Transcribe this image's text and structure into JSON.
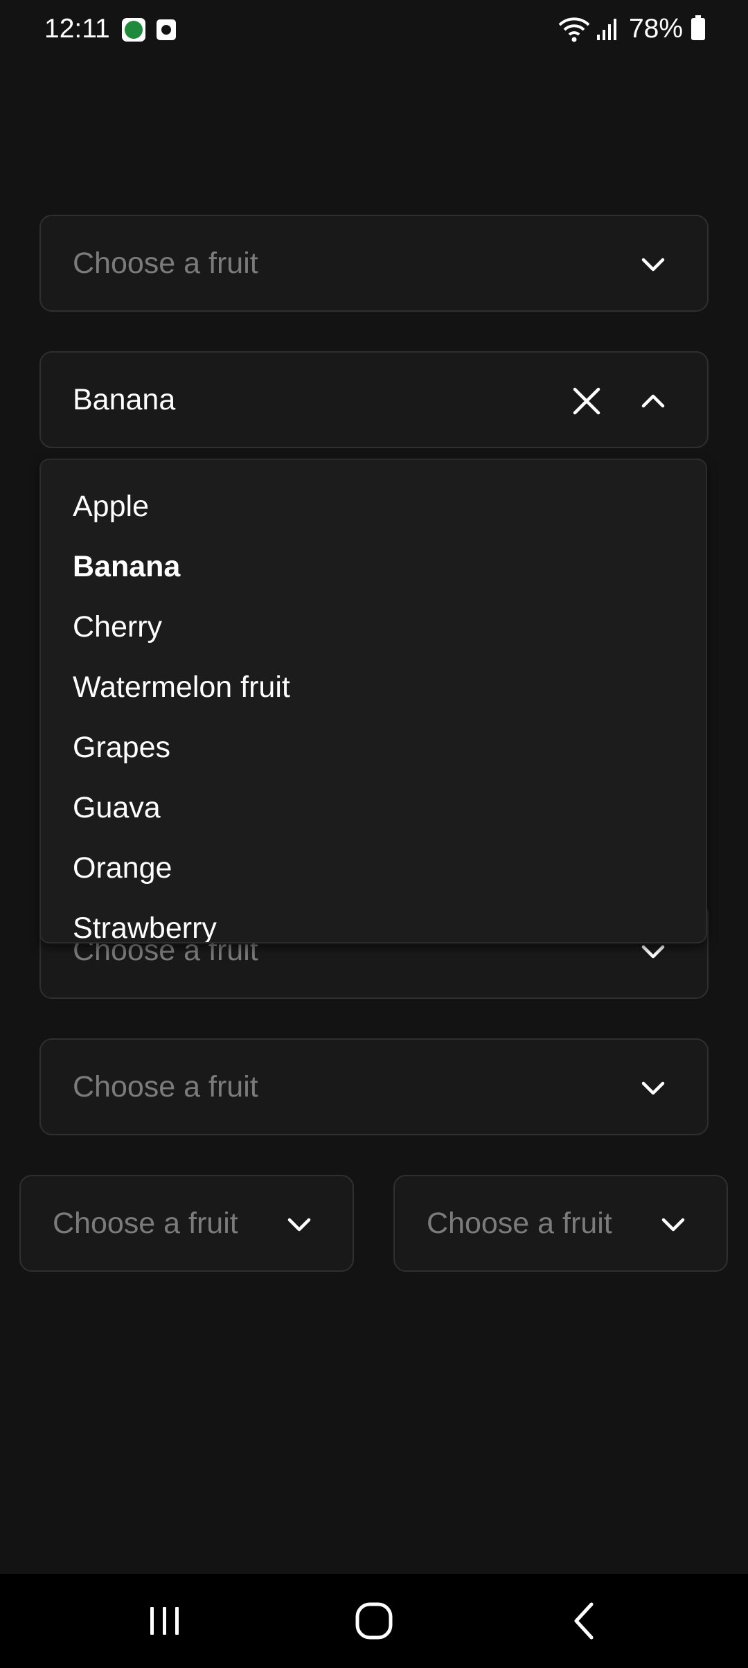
{
  "status_bar": {
    "time": "12:11",
    "battery": "78%",
    "notification_icons": [
      "wb-app-icon",
      "clock-app-icon"
    ],
    "system_icons": [
      "wifi-icon",
      "signal-icon",
      "battery-charging-icon"
    ]
  },
  "dropdowns": [
    {
      "id": "dropdown-1",
      "placeholder": "Choose a fruit",
      "value": ""
    },
    {
      "id": "dropdown-2",
      "placeholder": "Choose a fruit",
      "value": "Banana",
      "open": true
    },
    {
      "id": "dropdown-3",
      "placeholder": "Choose a fruit",
      "value": ""
    },
    {
      "id": "dropdown-4",
      "placeholder": "Choose a fruit",
      "value": ""
    },
    {
      "id": "dropdown-5",
      "placeholder": "Choose a fruit",
      "value": ""
    },
    {
      "id": "dropdown-6",
      "placeholder": "Choose a fruit",
      "value": ""
    }
  ],
  "menu": {
    "items": [
      "Apple",
      "Banana",
      "Cherry",
      "Watermelon fruit",
      "Grapes",
      "Guava",
      "Orange",
      "Strawberry"
    ],
    "selected": "Banana"
  },
  "colors": {
    "background": "#131313",
    "field_background": "#191919",
    "field_border": "#2f2f2f",
    "placeholder": "#7b7b7b",
    "menu_background": "#1c1c1c",
    "text": "#ffffff"
  }
}
